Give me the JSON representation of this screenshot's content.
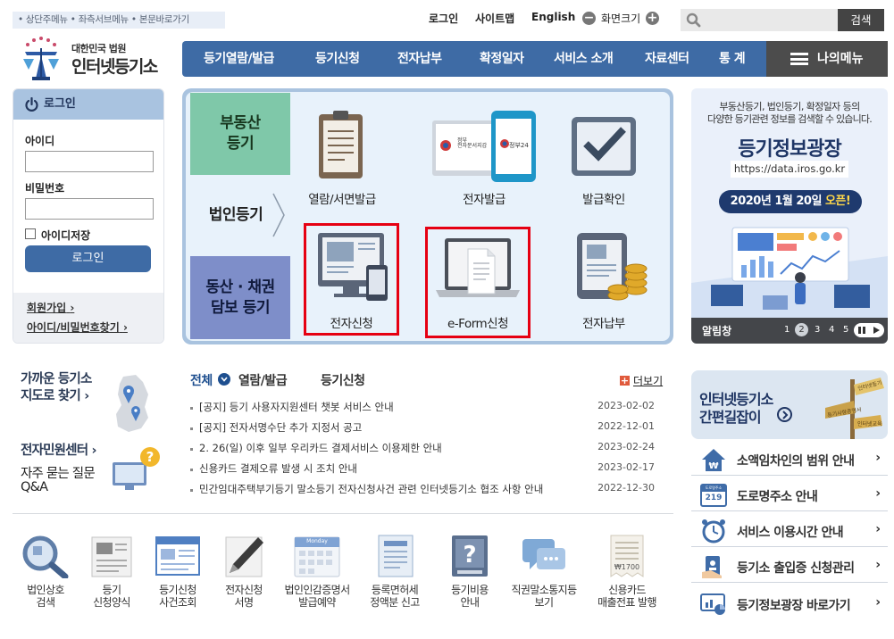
{
  "skip_links": "• 상단주메뉴 • 좌측서브메뉴 • 본문바로가기",
  "util": {
    "login": "로그인",
    "sitemap": "사이트맵",
    "english": "English",
    "zoom": "화면크기",
    "minus": "−",
    "plus": "+"
  },
  "search": {
    "placeholder": "",
    "button": "검색"
  },
  "logo": {
    "sub": "대한민국 법원",
    "main": "인터넷등기소"
  },
  "nav": [
    "등기열람/발급",
    "등기신청",
    "전자납부",
    "확정일자",
    "서비스 소개",
    "자료센터",
    "통 계"
  ],
  "my_menu": "나의메뉴",
  "login_box": {
    "title": "로그인",
    "id_label": "아이디",
    "pw_label": "비밀번호",
    "save_id": "아이디저장",
    "login_button": "로그인",
    "join": "회원가입",
    "find": "아이디/비밀번호찾기",
    "arrow": "›"
  },
  "categories": [
    "부동산\n등기",
    "법인등기",
    "동산 · 채권\n담보 등기"
  ],
  "services": [
    "열람/서면발급",
    "전자발급",
    "발급확인",
    "전자신청",
    "e-Form신청",
    "전자납부"
  ],
  "ebadge": {
    "left": "정부\n전자문서지갑",
    "right": "정부24"
  },
  "banner": {
    "desc1": "부동산등기, 법인등기, 확정일자 등의",
    "desc2": "다양한 등기관련 정보를 검색할 수 있습니다.",
    "title": "등기정보광장",
    "url": "https://data.iros.go.kr",
    "open_prefix": "2020년 1월 20일 ",
    "open_suffix": "오픈!",
    "footer_label": "알림창",
    "pages": [
      "1",
      "2",
      "3",
      "4",
      "5"
    ],
    "current_page": "2"
  },
  "quick": {
    "map1": "가까운 등기소",
    "map2": "지도로 찾기",
    "center": "전자민원센터",
    "faq1": "자주 묻는 질문",
    "faq2": "Q&A",
    "arrow": "›"
  },
  "notice_tabs": [
    "전체",
    "열람/발급",
    "등기신청"
  ],
  "more": "더보기",
  "notices": [
    {
      "title": "[공지] 등기 사용자지원센터 챗봇 서비스 안내",
      "date": "2023-02-02"
    },
    {
      "title": "[공지] 전자서명수단 추가 지정서 공고",
      "date": "2022-12-01"
    },
    {
      "title": "2. 26(일) 이후 일부 우리카드 결제서비스 이용제한 안내",
      "date": "2023-02-24"
    },
    {
      "title": "신용카드 결제오류 발생 시 조치 안내",
      "date": "2023-02-17"
    },
    {
      "title": "민간임대주택부기등기 말소등기 전자신청사건 관련 인터넷등기소 협조 사항 안내",
      "date": "2022-12-30"
    }
  ],
  "bottom": [
    {
      "l1": "법인상호",
      "l2": "검색"
    },
    {
      "l1": "등기",
      "l2": "신청양식"
    },
    {
      "l1": "등기신청",
      "l2": "사건조회"
    },
    {
      "l1": "전자신청",
      "l2": "서명"
    },
    {
      "l1": "법인인감증명서",
      "l2": "발급예약"
    },
    {
      "l1": "등록면허세",
      "l2": "정액분 신고"
    },
    {
      "l1": "등기비용",
      "l2": "안내"
    },
    {
      "l1": "직권말소통지등",
      "l2": "보기"
    },
    {
      "l1": "신용카드",
      "l2": "매출전표 발행"
    }
  ],
  "calendar_label": "Monday",
  "receipt_amount": "₩1700",
  "guide": {
    "l1": "인터넷등기소",
    "l2": "간편길잡이"
  },
  "sign_texts": [
    "인터넷등기",
    "등기사항증명서",
    "인터넷교육"
  ],
  "quick_links": [
    "소액임차인의 범위 안내",
    "도로명주소 안내",
    "서비스 이용시간 안내",
    "등기소 출입증 신청관리",
    "등기정보광장 바로가기"
  ],
  "road_icon": {
    "top": "도로명주소",
    "num": "219"
  },
  "colors": {
    "nav": "#3e6ba5",
    "accent_red": "#e60012",
    "category_green": "#7fc8a9",
    "category_purple": "#7e8ec9"
  }
}
